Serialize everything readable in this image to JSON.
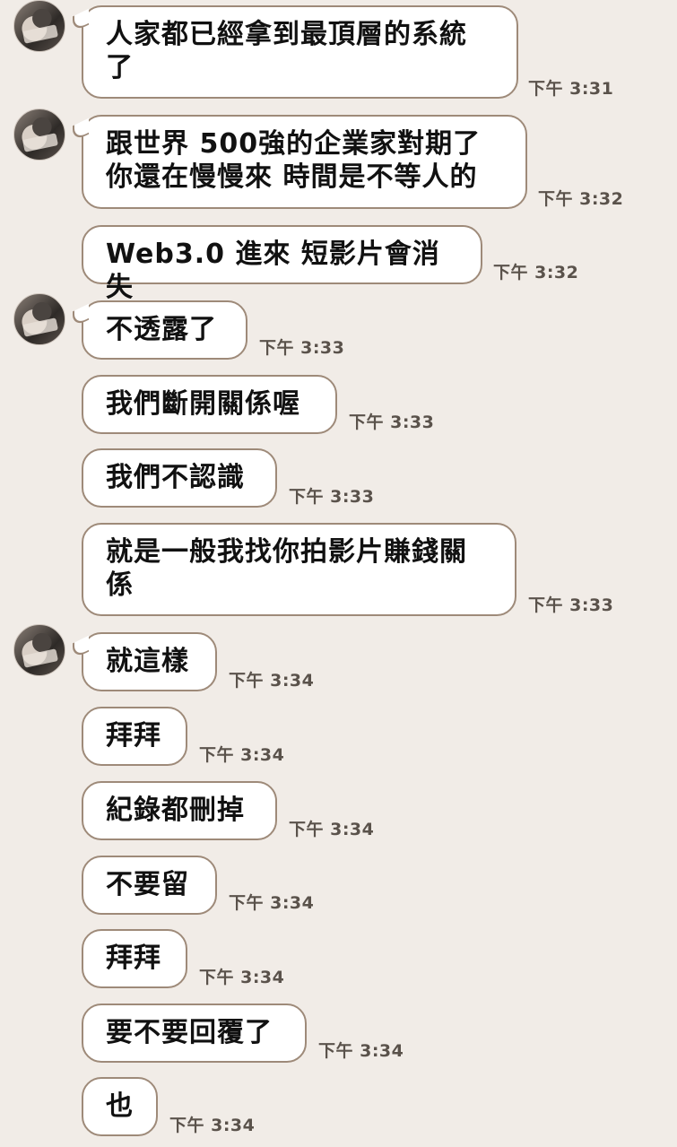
{
  "messages": [
    {
      "text": "人家都已經拿到最頂層的系統\n了",
      "time": "下午 3:31",
      "avatar": true
    },
    {
      "text": "跟世界 500強的企業家對期了\n你還在慢慢來 時間是不等人的",
      "time": "下午 3:32",
      "avatar": true
    },
    {
      "text": "Web3.0 進來 短影片會消失",
      "time": "下午 3:32",
      "avatar": false
    },
    {
      "text": "不透露了",
      "time": "下午 3:33",
      "avatar": true
    },
    {
      "text": "我們斷開關係喔",
      "time": "下午 3:33",
      "avatar": false
    },
    {
      "text": "我們不認識",
      "time": "下午 3:33",
      "avatar": false
    },
    {
      "text": "就是一般我找你拍影片賺錢關\n係",
      "time": "下午 3:33",
      "avatar": false
    },
    {
      "text": "就這樣",
      "time": "下午 3:34",
      "avatar": true
    },
    {
      "text": "拜拜",
      "time": "下午 3:34",
      "avatar": false
    },
    {
      "text": "紀錄都刪掉",
      "time": "下午 3:34",
      "avatar": false
    },
    {
      "text": "不要留",
      "time": "下午 3:34",
      "avatar": false
    },
    {
      "text": "拜拜",
      "time": "下午 3:34",
      "avatar": false
    },
    {
      "text": "要不要回覆了",
      "time": "下午 3:34",
      "avatar": false
    },
    {
      "text": "也",
      "time": "下午 3:34",
      "avatar": false
    }
  ]
}
